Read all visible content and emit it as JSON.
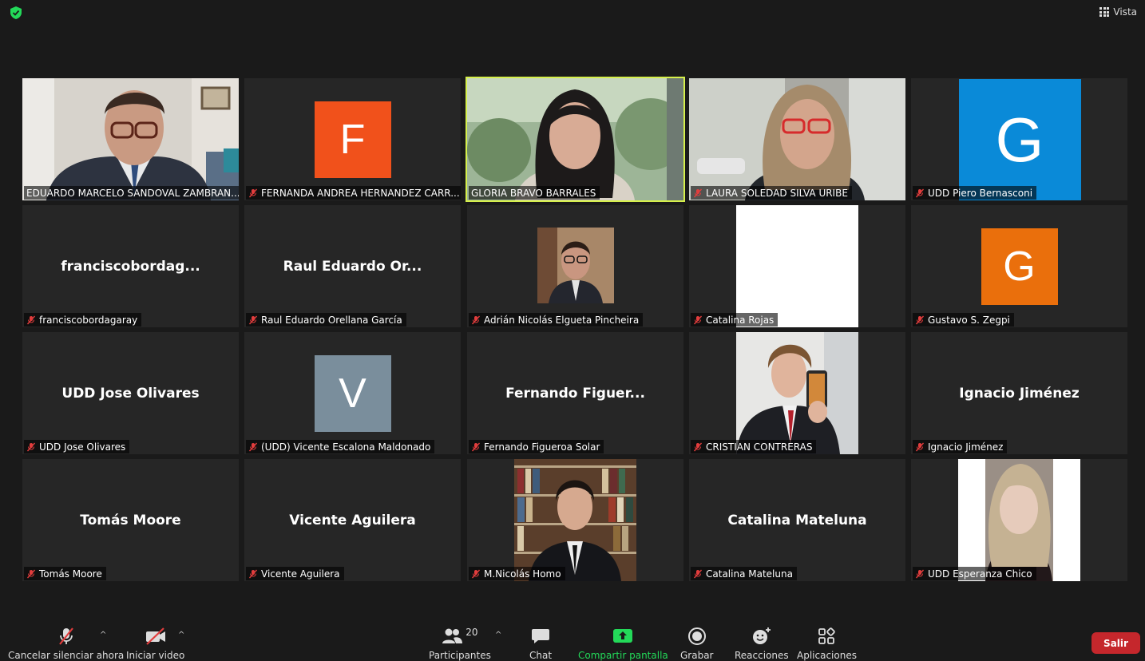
{
  "topbar": {
    "view_label": "Vista"
  },
  "participants": [
    {
      "name": "EDUARDO MARCELO SANDOVAL ZAMBRAN...",
      "display": "",
      "avatar_letter": "",
      "avatar_color": "",
      "muted": false,
      "active": false,
      "video": "office-man"
    },
    {
      "name": "FERNANDA ANDREA HERNANDEZ CARR...",
      "display": "",
      "avatar_letter": "F",
      "avatar_color": "#f1511b",
      "muted": true,
      "active": false,
      "video": ""
    },
    {
      "name": "GLORIA BRAVO BARRALES",
      "display": "",
      "avatar_letter": "",
      "avatar_color": "",
      "muted": false,
      "active": true,
      "video": "woman-garden"
    },
    {
      "name": "LAURA SOLEDAD SILVA URIBE",
      "display": "",
      "avatar_letter": "",
      "avatar_color": "",
      "muted": true,
      "active": false,
      "video": "woman-glasses"
    },
    {
      "name": "UDD Piero Bernasconi",
      "display": "",
      "avatar_letter": "G",
      "avatar_color": "#0a8ad8",
      "muted": true,
      "active": false,
      "video": "",
      "big_avatar": true
    },
    {
      "name": "franciscobordagaray",
      "display": "franciscobordag...",
      "avatar_letter": "",
      "avatar_color": "",
      "muted": true,
      "active": false,
      "video": ""
    },
    {
      "name": "Raul Eduardo Orellana García",
      "display": "Raul Eduardo Or...",
      "avatar_letter": "",
      "avatar_color": "",
      "muted": true,
      "active": false,
      "video": ""
    },
    {
      "name": "Adrián Nicolás Elgueta Pincheira",
      "display": "",
      "avatar_letter": "",
      "avatar_color": "",
      "muted": true,
      "active": false,
      "video": "profile-photo"
    },
    {
      "name": "Catalina Rojas",
      "display": "",
      "avatar_letter": "",
      "avatar_color": "",
      "muted": true,
      "active": false,
      "video": "white"
    },
    {
      "name": "Gustavo S. Zegpi",
      "display": "",
      "avatar_letter": "G",
      "avatar_color": "#ea6f0c",
      "muted": true,
      "active": false,
      "video": ""
    },
    {
      "name": "UDD Jose Olivares",
      "display": "UDD Jose Olivares",
      "avatar_letter": "",
      "avatar_color": "",
      "muted": true,
      "active": false,
      "video": ""
    },
    {
      "name": "(UDD) Vicente Escalona Maldonado",
      "display": "",
      "avatar_letter": "V",
      "avatar_color": "#7a8e9c",
      "muted": true,
      "active": false,
      "video": ""
    },
    {
      "name": "Fernando Figueroa Solar",
      "display": "Fernando  Figuer...",
      "avatar_letter": "",
      "avatar_color": "",
      "muted": true,
      "active": false,
      "video": ""
    },
    {
      "name": "CRISTIAN CONTRERAS",
      "display": "",
      "avatar_letter": "",
      "avatar_color": "",
      "muted": true,
      "active": false,
      "video": "selfie-man"
    },
    {
      "name": "Ignacio Jiménez",
      "display": "Ignacio Jiménez",
      "avatar_letter": "",
      "avatar_color": "",
      "muted": true,
      "active": false,
      "video": ""
    },
    {
      "name": "Tomás Moore",
      "display": "Tomás Moore",
      "avatar_letter": "",
      "avatar_color": "",
      "muted": true,
      "active": false,
      "video": ""
    },
    {
      "name": "Vicente Aguilera",
      "display": "Vicente Aguilera",
      "avatar_letter": "",
      "avatar_color": "",
      "muted": true,
      "active": false,
      "video": ""
    },
    {
      "name": "M.Nicolás Homo",
      "display": "",
      "avatar_letter": "",
      "avatar_color": "",
      "muted": true,
      "active": false,
      "video": "library-man"
    },
    {
      "name": "Catalina Mateluna",
      "display": "Catalina Mateluna",
      "avatar_letter": "",
      "avatar_color": "",
      "muted": true,
      "active": false,
      "video": ""
    },
    {
      "name": "UDD Esperanza Chico",
      "display": "",
      "avatar_letter": "",
      "avatar_color": "",
      "muted": true,
      "active": false,
      "video": "portrait-girl"
    }
  ],
  "toolbar": {
    "mute_label": "Cancelar silenciar ahora",
    "video_label": "Iniciar video",
    "participants_label": "Participantes",
    "participants_count": "20",
    "chat_label": "Chat",
    "share_label": "Compartir pantalla",
    "record_label": "Grabar",
    "reactions_label": "Reacciones",
    "apps_label": "Aplicaciones",
    "leave_label": "Salir",
    "share_color": "#23d959",
    "leave_color": "#c5272c"
  }
}
